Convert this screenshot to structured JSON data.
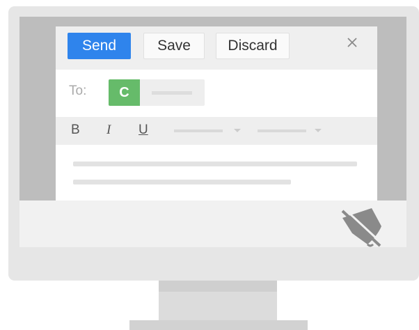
{
  "compose": {
    "toolbar": {
      "send_label": "Send",
      "save_label": "Save",
      "discard_label": "Discard",
      "close_glyph": "×"
    },
    "recipient": {
      "to_label": "To:",
      "avatar_initial": "C",
      "avatar_color": "#66bb6a"
    },
    "formatting": {
      "bold_label": "B",
      "italic_label": "I",
      "underline_label": "U"
    }
  },
  "colors": {
    "send_button": "#2f84ec",
    "screen_bezel": "#bdbdbd",
    "monitor_body": "#e6e6e6"
  },
  "icons": {
    "close": "close-icon",
    "notifications": "notifications-off-icon"
  }
}
